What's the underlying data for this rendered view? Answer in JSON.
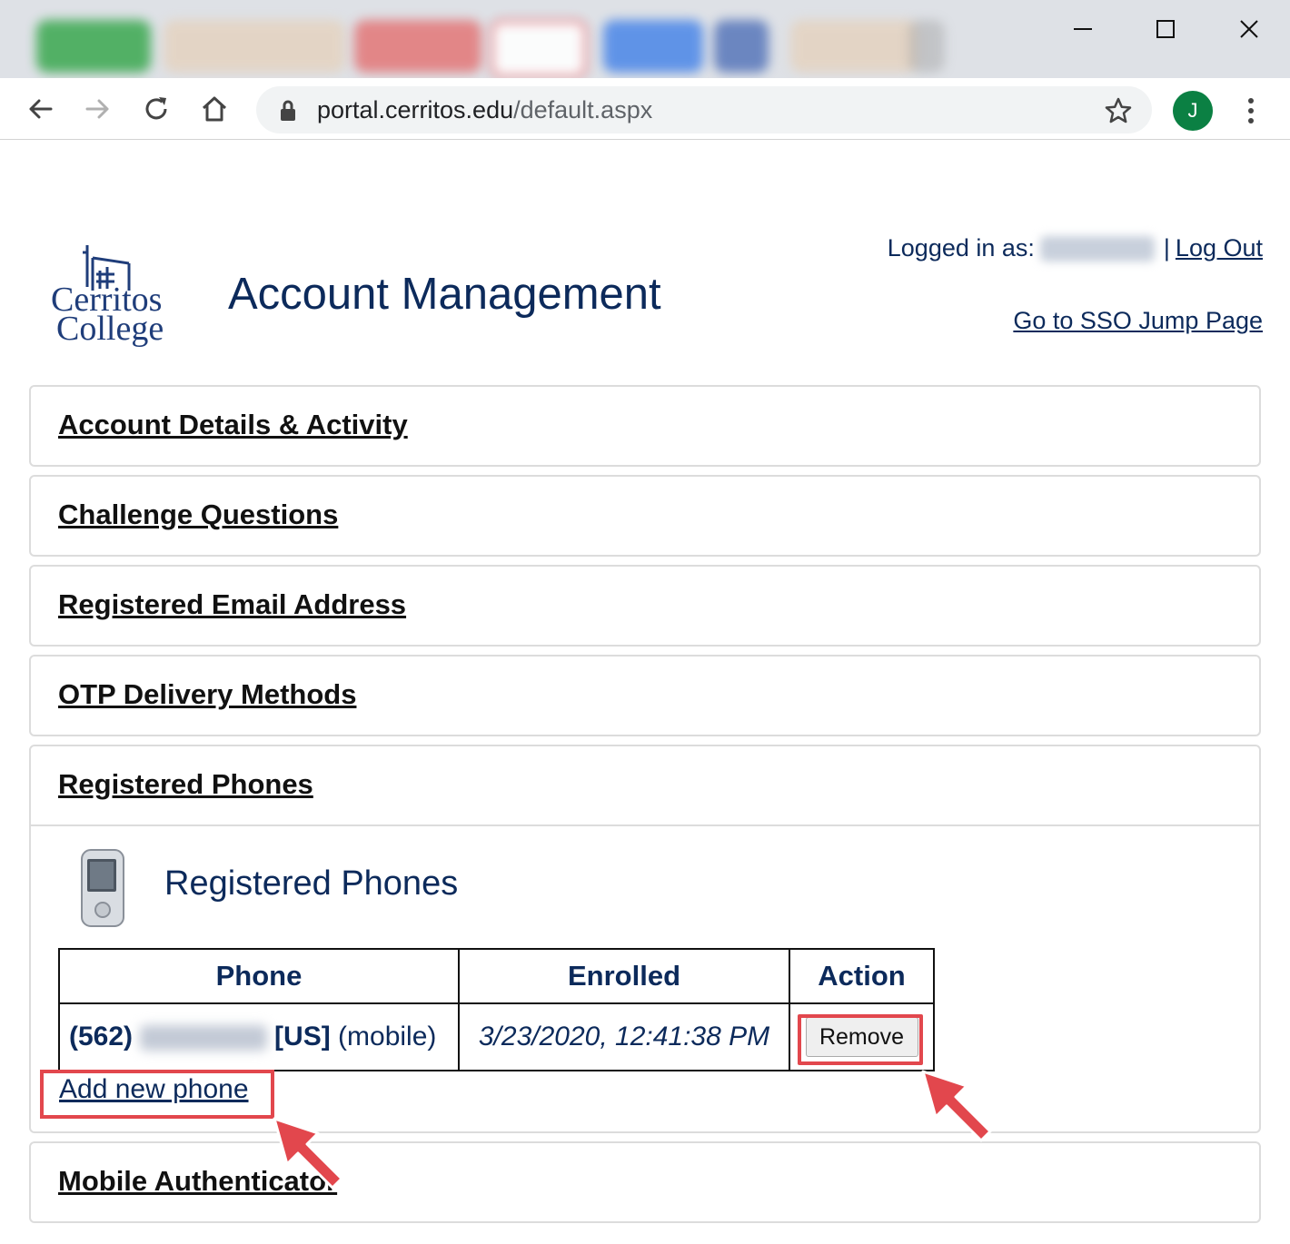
{
  "browser": {
    "url_domain": "portal.cerritos.edu",
    "url_path": "/default.aspx",
    "profile_initial": "J",
    "icons": [
      "back-icon",
      "forward-icon",
      "reload-icon",
      "home-icon",
      "lock-icon",
      "star-icon",
      "kebab-menu-icon",
      "minimize-icon",
      "maximize-icon",
      "close-icon"
    ]
  },
  "header": {
    "logo_line1": "Cerritos",
    "logo_line2": "College",
    "title": "Account Management",
    "logged_in_label": "Logged in as:",
    "separator": "|",
    "logout": "Log Out",
    "sso_link": "Go to SSO Jump Page"
  },
  "sections": {
    "account_details": "Account Details & Activity",
    "challenge_questions": "Challenge Questions",
    "registered_email": "Registered Email Address",
    "otp_methods": "OTP Delivery Methods",
    "registered_phones": "Registered Phones",
    "mobile_authenticator": "Mobile Authenticator"
  },
  "phones": {
    "subtitle": "Registered Phones",
    "columns": [
      "Phone",
      "Enrolled",
      "Action"
    ],
    "rows": [
      {
        "area_code": "(562)",
        "country": "[US]",
        "type": "(mobile)",
        "enrolled": "3/23/2020, 12:41:38 PM",
        "action": "Remove"
      }
    ],
    "add_link": "Add new phone"
  },
  "colors": {
    "brand_navy": "#0c2a5b",
    "highlight_red": "#e2474d",
    "avatar_green": "#0b8043"
  }
}
